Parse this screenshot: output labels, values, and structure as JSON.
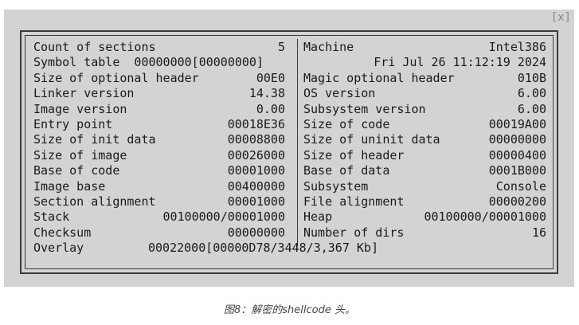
{
  "window": {
    "close_label": "[x]"
  },
  "left_rows": [
    {
      "label": "Count of sections",
      "value": "5"
    },
    {
      "label": "Symbol table  00000000[00000000]",
      "value": ""
    },
    {
      "label": "Size of optional header",
      "value": "00E0"
    },
    {
      "label": "Linker version",
      "value": "14.38"
    },
    {
      "label": "Image version",
      "value": "0.00"
    },
    {
      "label": "Entry point",
      "value": "00018E36"
    },
    {
      "label": "Size of init data",
      "value": "00008800"
    },
    {
      "label": "Size of image",
      "value": "00026000"
    },
    {
      "label": "Base of code",
      "value": "00001000"
    },
    {
      "label": "Image base",
      "value": "00400000"
    },
    {
      "label": "Section alignment",
      "value": "00001000"
    },
    {
      "label": "Stack",
      "value": "00100000/00001000"
    },
    {
      "label": "Checksum",
      "value": "00000000"
    }
  ],
  "right_rows": [
    {
      "label": "Machine",
      "value": "Intel386"
    },
    {
      "label": "",
      "value": "Fri Jul 26 11:12:19 2024"
    },
    {
      "label": "Magic optional header",
      "value": "010B"
    },
    {
      "label": "OS version",
      "value": "6.00"
    },
    {
      "label": "Subsystem version",
      "value": "6.00"
    },
    {
      "label": "Size of code",
      "value": "00019A00"
    },
    {
      "label": "Size of uninit data",
      "value": "00000000"
    },
    {
      "label": "Size of header",
      "value": "00000400"
    },
    {
      "label": "Base of data",
      "value": "0001B000"
    },
    {
      "label": "Subsystem",
      "value": "Console"
    },
    {
      "label": "File alignment",
      "value": "00000200"
    },
    {
      "label": "Heap",
      "value": "00100000/00001000"
    },
    {
      "label": "Number of dirs",
      "value": "16"
    }
  ],
  "overlay_row": {
    "label": "Overlay",
    "value": "00022000[00000D78/3448/3,367 Kb]"
  },
  "caption": "图8：解密的shellcode 头。"
}
